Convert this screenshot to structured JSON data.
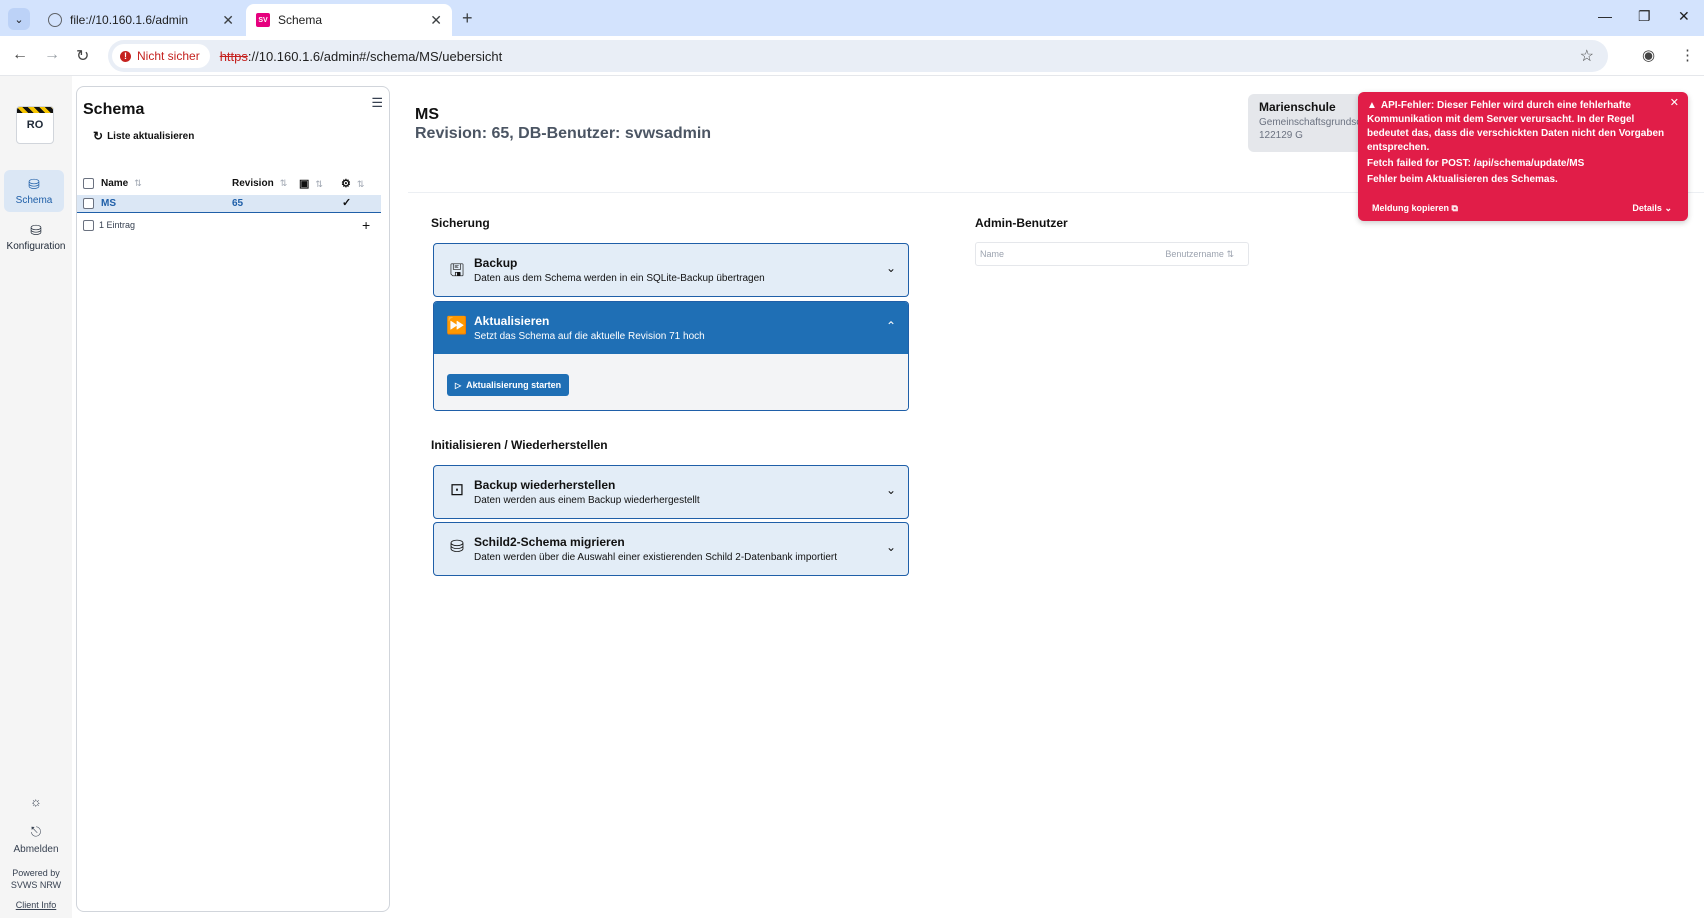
{
  "browser": {
    "tabs": [
      {
        "title": "file://10.160.1.6/admin"
      },
      {
        "title": "Schema"
      }
    ],
    "not_secure_label": "Nicht sicher",
    "url_scheme": "https",
    "url_rest": "://10.160.1.6/admin#/schema/MS/uebersicht"
  },
  "rail": {
    "logo_text": "RO",
    "items": [
      {
        "label": "Schema"
      },
      {
        "label": "Konfiguration"
      }
    ],
    "logout_label": "Abmelden",
    "powered_line1": "Powered by",
    "powered_line2": "SVWS NRW",
    "client_info": "Client Info"
  },
  "schema_list": {
    "title": "Schema",
    "refresh_label": "Liste aktualisieren",
    "columns": {
      "name": "Name",
      "revision": "Revision"
    },
    "rows": [
      {
        "name": "MS",
        "revision": "65"
      }
    ],
    "count_label": "1 Eintrag"
  },
  "main": {
    "title": "MS",
    "subtitle": "Revision: 65, DB-Benutzer: svwsadmin",
    "school": {
      "name": "Marienschule",
      "type": "Gemeinschaftsgrundschule",
      "number": "122129 G"
    },
    "sicherung_heading": "Sicherung",
    "backup": {
      "title": "Backup",
      "desc": "Daten aus dem Schema werden in ein SQLite-Backup übertragen"
    },
    "update": {
      "title": "Aktualisieren",
      "desc": "Setzt das Schema auf die aktuelle Revision 71 hoch",
      "button": "Aktualisierung starten"
    },
    "init_heading": "Initialisieren / Wiederherstellen",
    "restore": {
      "title": "Backup wiederherstellen",
      "desc": "Daten werden aus einem Backup wiederhergestellt"
    },
    "migrate": {
      "title": "Schild2-Schema migrieren",
      "desc": "Daten werden über die Auswahl einer existierenden Schild 2-Datenbank importiert"
    },
    "admin_heading": "Admin-Benutzer",
    "admin_columns": {
      "name": "Name",
      "username": "Benutzername"
    }
  },
  "toast": {
    "message": "API-Fehler: Dieser Fehler wird durch eine fehlerhafte Kommunikation mit dem Server verursacht. In der Regel bedeutet das, dass die verschickten Daten nicht den Vorgaben entsprechen.",
    "line1": "Fetch failed for POST: /api/schema/update/MS",
    "line2": "Fehler beim Aktualisieren des Schemas.",
    "copy_label": "Meldung kopieren",
    "details_label": "Details"
  },
  "colors": {
    "accent": "#1f6fb5",
    "error": "#e11d48",
    "tab_bar": "#d3e3fd"
  }
}
